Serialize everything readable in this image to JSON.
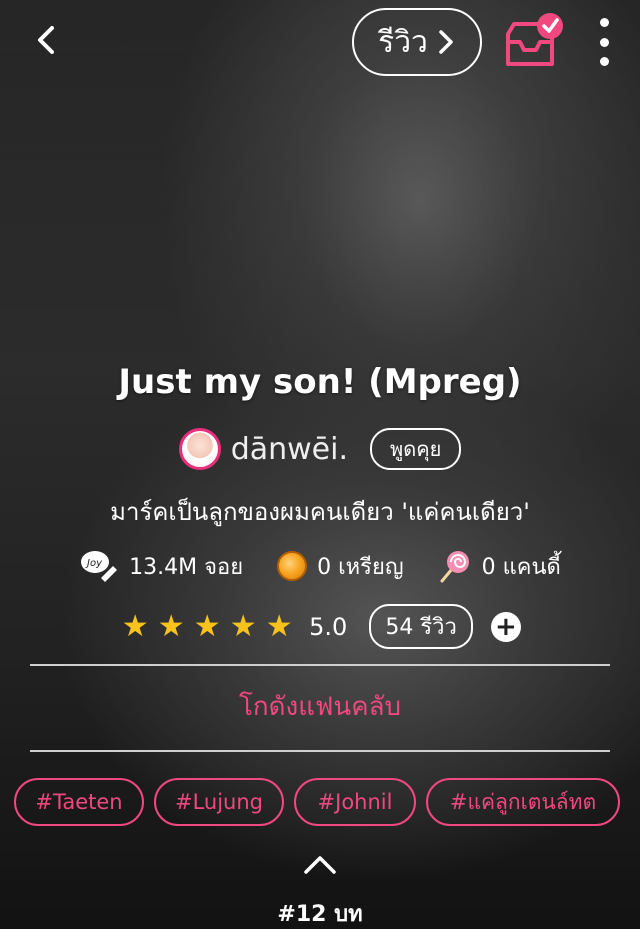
{
  "header": {
    "back_icon": "chevron-left-icon",
    "review_label": "รีวิว",
    "inbox_icon": "inbox-check-icon",
    "more_icon": "more-vertical-icon"
  },
  "story": {
    "title": "Just my son! (Mpreg)",
    "author": "dānwēi.",
    "talk_label": "พูดคุย",
    "description": "มาร์คเป็นลูกของผมคนเดียว 'แค่คนเดียว'"
  },
  "stats": {
    "reads": "13.4M จอย",
    "coins": "0 เหรียญ",
    "candies": "0 แคนดี้"
  },
  "rating": {
    "stars": 5,
    "score": "5.0",
    "reviews_label": "54 รีวิว"
  },
  "fanclub_label": "โกดังแฟนคลับ",
  "tags": [
    "#Taeten",
    "#Lujung",
    "#Johnil",
    "#แค่ลูกเตนล์ทต"
  ],
  "chapter_label": "#12 บท",
  "colors": {
    "accent": "#f0487f",
    "star": "#f6c21b"
  }
}
